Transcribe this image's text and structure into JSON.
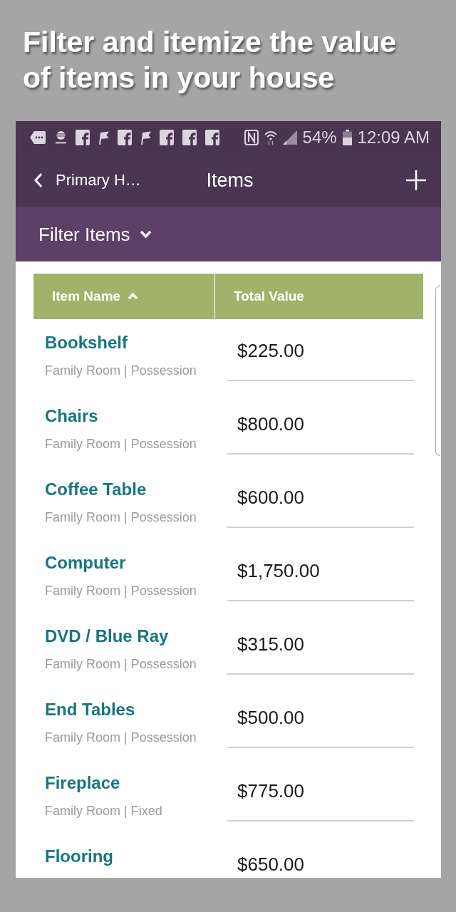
{
  "headline": "Filter and itemize the value of items in your house",
  "status_bar": {
    "battery": "54%",
    "time": "12:09 AM"
  },
  "nav": {
    "back_label": "Primary H…",
    "title": "Items"
  },
  "filter": {
    "label": "Filter Items",
    "expanded": false
  },
  "table": {
    "columns": [
      {
        "label": "Item Name",
        "sorted": true,
        "descending": false
      },
      {
        "label": "Total Value",
        "sorted": false
      }
    ],
    "rows": [
      {
        "name": "Bookshelf",
        "details": "Family Room | Possession",
        "value": "$225.00"
      },
      {
        "name": "Chairs",
        "details": "Family Room | Possession",
        "value": "$800.00"
      },
      {
        "name": "Coffee Table",
        "details": "Family Room | Possession",
        "value": "$600.00"
      },
      {
        "name": "Computer",
        "details": "Family Room | Possession",
        "value": "$1,750.00"
      },
      {
        "name": "DVD / Blue Ray",
        "details": "Family Room | Possession",
        "value": "$315.00"
      },
      {
        "name": "End Tables",
        "details": "Family Room | Possession",
        "value": "$500.00"
      },
      {
        "name": "Fireplace",
        "details": "Family Room | Fixed",
        "value": "$775.00"
      },
      {
        "name": "Flooring",
        "value": "$650.00"
      }
    ]
  }
}
